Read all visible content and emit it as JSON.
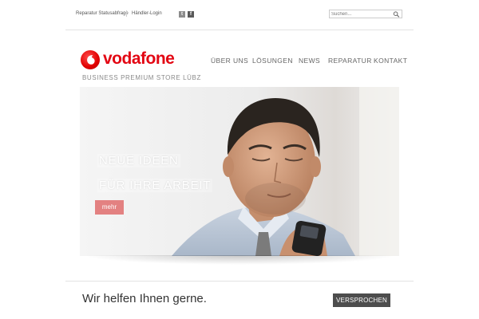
{
  "topbar": {
    "link_repair_status": "Reparatur Statusabfrage",
    "link_dealer_login": "Händler-Login",
    "social": [
      {
        "icon": "twitter-icon",
        "glyph": "t",
        "color": "#8c8c8c"
      },
      {
        "icon": "facebook-icon",
        "glyph": "f",
        "color": "#5a5a5a"
      }
    ],
    "search": {
      "placeholder": "Suchen...",
      "value": ""
    }
  },
  "brand": {
    "logo_text": "vodafone",
    "store_name": "BUSINESS PREMIUM STORE LÜBZ",
    "brand_color": "#e30613"
  },
  "nav": {
    "items": [
      "ÜBER UNS",
      "LÖSUNGEN",
      "NEWS",
      "REPARATUR",
      "KONTAKT"
    ]
  },
  "hero": {
    "line1": "NEUE IDEEN",
    "line2": "FÜR IHRE ARBEIT",
    "more_label": "mehr",
    "accent": "#e38181"
  },
  "footer": {
    "tagline": "Wir helfen Ihnen gerne.",
    "button_label": "VERSPROCHEN"
  }
}
